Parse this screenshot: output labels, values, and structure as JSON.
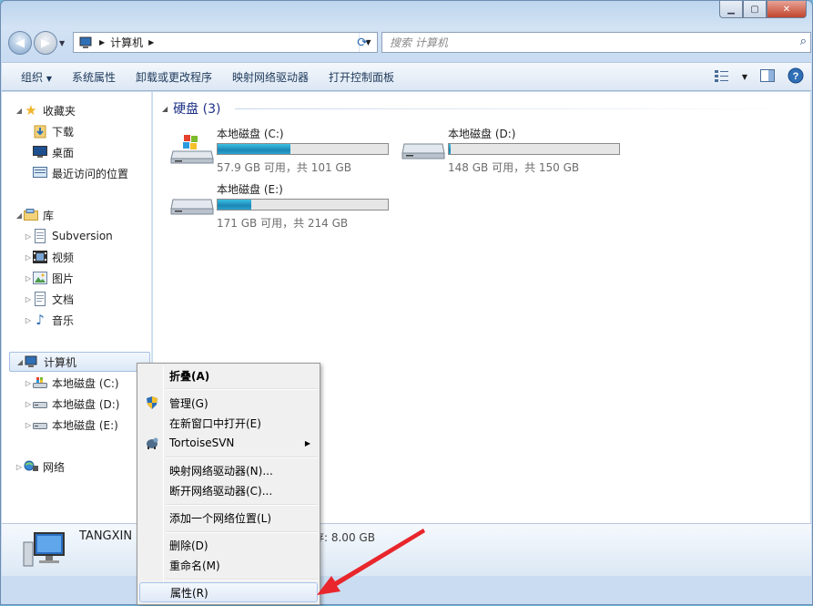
{
  "window": {
    "minimize_icon": "minimize-icon",
    "maximize_icon": "maximize-icon",
    "close_icon": "close-icon"
  },
  "nav": {
    "back_icon": "back-arrow-icon",
    "forward_icon": "forward-arrow-icon",
    "address_path": "计算机",
    "search_placeholder": "搜索 计算机"
  },
  "toolbar": {
    "organize": "组织",
    "system_properties": "系统属性",
    "uninstall": "卸载或更改程序",
    "map_drive": "映射网络驱动器",
    "control_panel": "打开控制面板"
  },
  "sidebar": {
    "favorites": "收藏夹",
    "downloads": "下载",
    "desktop": "桌面",
    "recent": "最近访问的位置",
    "libraries": "库",
    "subversion": "Subversion",
    "videos": "视频",
    "pictures": "图片",
    "documents": "文档",
    "music": "音乐",
    "computer": "计算机",
    "drive_c": "本地磁盘 (C:)",
    "drive_d": "本地磁盘 (D:)",
    "drive_e": "本地磁盘 (E:)",
    "network": "网络"
  },
  "main": {
    "group_title": "硬盘 (3)",
    "drives": [
      {
        "name": "本地磁盘 (C:)",
        "free": "57.9 GB 可用，共 101 GB",
        "used_fraction": 0.43
      },
      {
        "name": "本地磁盘 (D:)",
        "free": "148 GB 可用，共 150 GB",
        "used_fraction": 0.013
      },
      {
        "name": "本地磁盘 (E:)",
        "free": "171 GB 可用，共 214 GB",
        "used_fraction": 0.2
      }
    ]
  },
  "details": {
    "computer_name": "TANGXIN",
    "memory": "存: 8.00 GB"
  },
  "context_menu": {
    "collapse": "折叠(A)",
    "manage": "管理(G)",
    "open_new_window": "在新窗口中打开(E)",
    "tortoise": "TortoiseSVN",
    "map_drive": "映射网络驱动器(N)...",
    "disconnect_drive": "断开网络驱动器(C)...",
    "add_network_location": "添加一个网络位置(L)",
    "delete": "删除(D)",
    "rename": "重命名(M)",
    "properties": "属性(R)"
  },
  "colors": {
    "drive_bar": "#26a0da",
    "accent_arrow": "#e8262b"
  }
}
